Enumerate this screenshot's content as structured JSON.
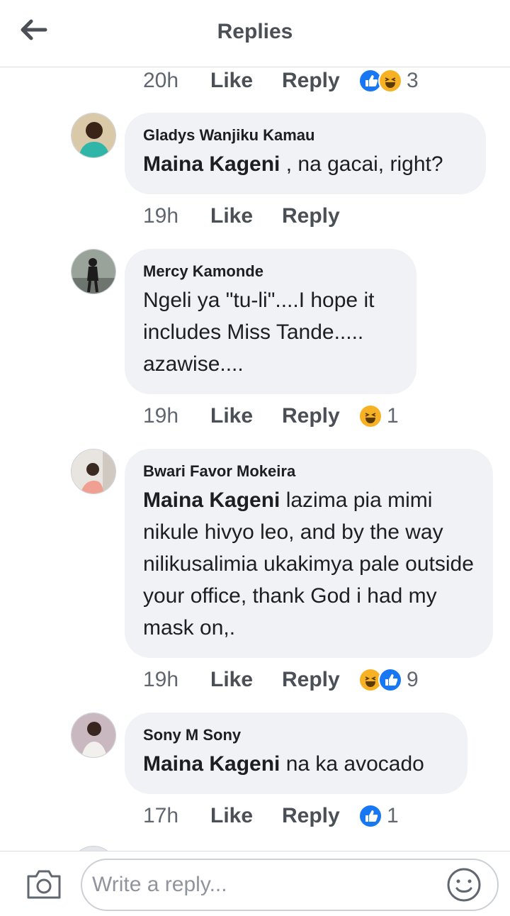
{
  "header": {
    "title": "Replies"
  },
  "top_meta": {
    "time": "20h",
    "like": "Like",
    "reply": "Reply",
    "reaction_count": "3",
    "reactions": [
      "like-icon",
      "haha-icon"
    ]
  },
  "comments": [
    {
      "author": "Gladys Wanjiku Kamau",
      "mention": "Maina Kageni",
      "text": " , na gacai, right?",
      "time": "19h",
      "like": "Like",
      "reply": "Reply",
      "reaction_count": "",
      "reactions": []
    },
    {
      "author": "Mercy Kamonde",
      "mention": "",
      "text": "Ngeli ya \"tu-li\"....I hope it includes Miss Tande..... azawise....",
      "time": "19h",
      "like": "Like",
      "reply": "Reply",
      "reaction_count": "1",
      "reactions": [
        "haha-icon"
      ]
    },
    {
      "author": "Bwari Favor Mokeira",
      "mention": "Maina Kageni",
      "text": " lazima pia mimi nikule hivyo leo, and by the way nilikusalimia ukakimya pale outside your office, thank God i had my mask on,.",
      "time": "19h",
      "like": "Like",
      "reply": "Reply",
      "reaction_count": "9",
      "reactions": [
        "haha-icon",
        "like-icon"
      ]
    },
    {
      "author": "Sony M Sony",
      "mention": "Maina Kageni",
      "text": " na ka avocado",
      "time": "17h",
      "like": "Like",
      "reply": "Reply",
      "reaction_count": "1",
      "reactions": [
        "like-icon"
      ]
    }
  ],
  "composer": {
    "placeholder": "Write a reply..."
  },
  "colors": {
    "like_blue": "#1877f2",
    "haha_yellow": "#f7b125",
    "bubble_gray": "#f0f2f5",
    "secondary_text": "#606770",
    "action_text": "#4b4f56"
  }
}
